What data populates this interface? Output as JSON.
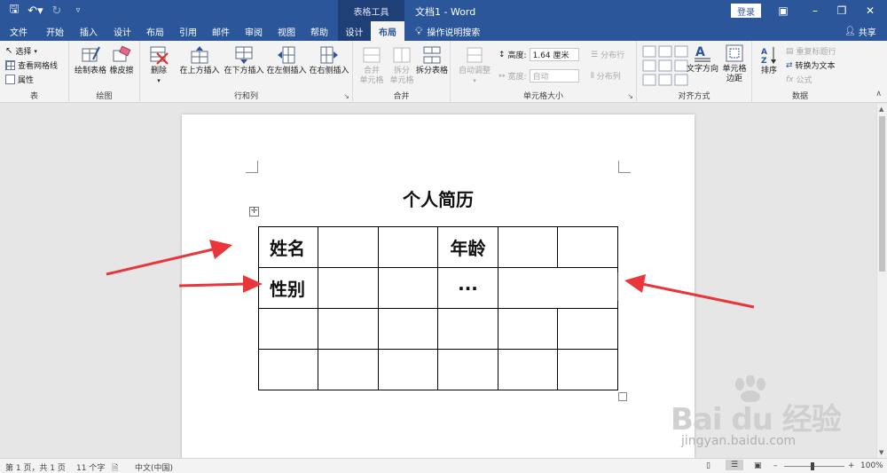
{
  "app": {
    "window_title": "文档1  -  Word",
    "contextual_tools": "表格工具",
    "login_label": "登录",
    "share_label": "共享",
    "tell_me": "操作说明搜索"
  },
  "tabs": [
    "文件",
    "开始",
    "插入",
    "设计",
    "布局",
    "引用",
    "邮件",
    "审阅",
    "视图",
    "帮助",
    "设计",
    "布局"
  ],
  "ribbon": {
    "table_group": {
      "label": "表",
      "select": "选择",
      "view_gridlines": "查看网格线",
      "properties": "属性"
    },
    "draw_group": {
      "label": "绘图",
      "draw_table": "绘制表格",
      "eraser": "橡皮擦"
    },
    "rows_cols_group": {
      "label": "行和列",
      "delete": "删除",
      "insert_above": "在上方插入",
      "insert_below": "在下方插入",
      "insert_left": "在左侧插入",
      "insert_right": "在右侧插入"
    },
    "merge_group": {
      "label": "合并",
      "merge_cells": "合并\n单元格",
      "split_cells": "拆分\n单元格",
      "split_table": "拆分表格"
    },
    "cell_size_group": {
      "label": "单元格大小",
      "autofit": "自动调整",
      "height_label": "高度:",
      "height_value": "1.64 厘米",
      "width_label": "宽度:",
      "width_value": "自动",
      "distribute_rows": "分布行",
      "distribute_cols": "分布列"
    },
    "alignment_group": {
      "label": "对齐方式",
      "text_direction": "文字方向",
      "cell_margins": "单元格\n边距"
    },
    "data_group": {
      "label": "数据",
      "sort": "排序",
      "repeat_header": "重复标题行",
      "convert_text": "转换为文本",
      "formula": "公式"
    }
  },
  "document": {
    "heading": "个人简历",
    "table": {
      "rows": [
        [
          {
            "text": "姓名"
          },
          {
            "text": ""
          },
          {
            "text": ""
          },
          {
            "text": "年龄"
          },
          {
            "text": ""
          },
          {
            "text": ""
          }
        ],
        [
          {
            "text": "性别"
          },
          {
            "text": ""
          },
          {
            "text": ""
          },
          {
            "text": "···"
          },
          {
            "text": "",
            "colspan": 2
          }
        ],
        [
          {
            "text": ""
          },
          {
            "text": ""
          },
          {
            "text": ""
          },
          {
            "text": ""
          },
          {
            "text": ""
          },
          {
            "text": ""
          }
        ],
        [
          {
            "text": ""
          },
          {
            "text": ""
          },
          {
            "text": ""
          },
          {
            "text": ""
          },
          {
            "text": ""
          },
          {
            "text": ""
          }
        ]
      ]
    }
  },
  "status": {
    "page_info": "第 1 页，共 1 页",
    "word_count": "11 个字",
    "language": "中文(中国)",
    "zoom": "100%"
  },
  "watermark": {
    "main": "Bai du 经验",
    "sub": "jingyan.baidu.com"
  },
  "colors": {
    "title_bar": "#2b579a",
    "arrow": "#e8363a"
  }
}
